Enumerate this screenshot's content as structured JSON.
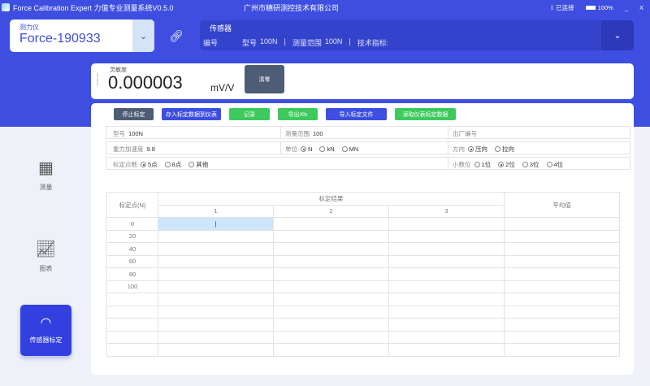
{
  "titlebar": {
    "app_title": "Force Calibration Expert 力值专业测量系统V0.5.0",
    "company": "广州市穗研测控技术有限公司",
    "bluetooth_status": "已连接",
    "battery": "100%",
    "minimize": "_",
    "close": "X"
  },
  "meter": {
    "label": "测力仪",
    "value": "Force-190933"
  },
  "sensor": {
    "title": "传感器",
    "serial_label": "编号",
    "model_label": "型号",
    "model": "100N",
    "range_label": "测量范围",
    "range": "100N",
    "spec_label": "技术指标:",
    "divider": "|"
  },
  "sensitivity": {
    "label": "灵敏度",
    "value": "0.000003",
    "unit": "mV/V",
    "zero_button": "清零"
  },
  "toolbar": {
    "stop": "停止标定",
    "save_to_meter": "存入标定数据到仪表",
    "record": "记录",
    "export": "导出Xls",
    "import": "导入标定文件",
    "read_meter": "读取仪表标定数据"
  },
  "form": {
    "model_label": "型号",
    "model": "100N",
    "range_label": "测量范围",
    "range": "100",
    "factory_no_label": "出厂编号",
    "gravity_label": "重力加速度",
    "gravity": "9.8",
    "unit_label": "单位",
    "units": [
      "N",
      "kN",
      "MN"
    ],
    "direction_label": "方向",
    "directions": [
      "压向",
      "拉向"
    ],
    "points_label": "标定点数",
    "points": [
      "5点",
      "8点",
      "其他"
    ],
    "decimals_label": "小数位",
    "decimals": [
      "1位",
      "2位",
      "3位",
      "4位"
    ]
  },
  "table": {
    "point_header": "标定点(N)",
    "result_header": "标定结果",
    "avg_header": "平均值",
    "runs": [
      "1",
      "2",
      "3"
    ],
    "points": [
      "0",
      "20",
      "40",
      "60",
      "80",
      "100"
    ],
    "cursor": "|"
  },
  "sidebar": {
    "items": [
      {
        "label": "测量"
      },
      {
        "label": "图表"
      },
      {
        "label": "传感器标定"
      }
    ]
  },
  "colors": {
    "primary": "#3d4ee0",
    "green": "#3ec95c",
    "dark": "#4d5d75"
  }
}
